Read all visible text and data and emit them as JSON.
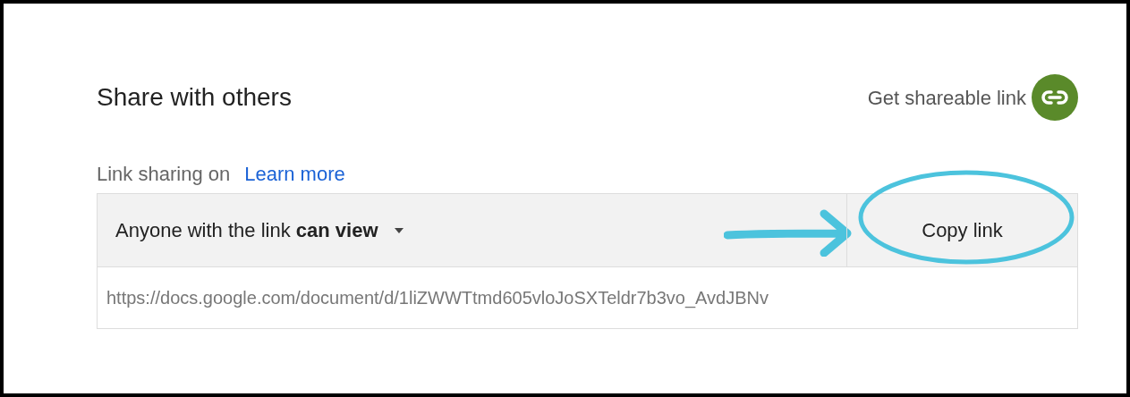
{
  "title": "Share with others",
  "shareable_link": {
    "label": "Get shareable link"
  },
  "status": {
    "text": "Link sharing on",
    "link": "Learn more"
  },
  "access": {
    "value": "Anyone with the link **can view**"
  },
  "copy_button": {
    "label": "Copy link"
  },
  "url": {
    "value": "https://docs.google.com/document/d/1liZWWTtmd605vloJoSXTeldr7b3vo_AvdJBNv"
  }
}
